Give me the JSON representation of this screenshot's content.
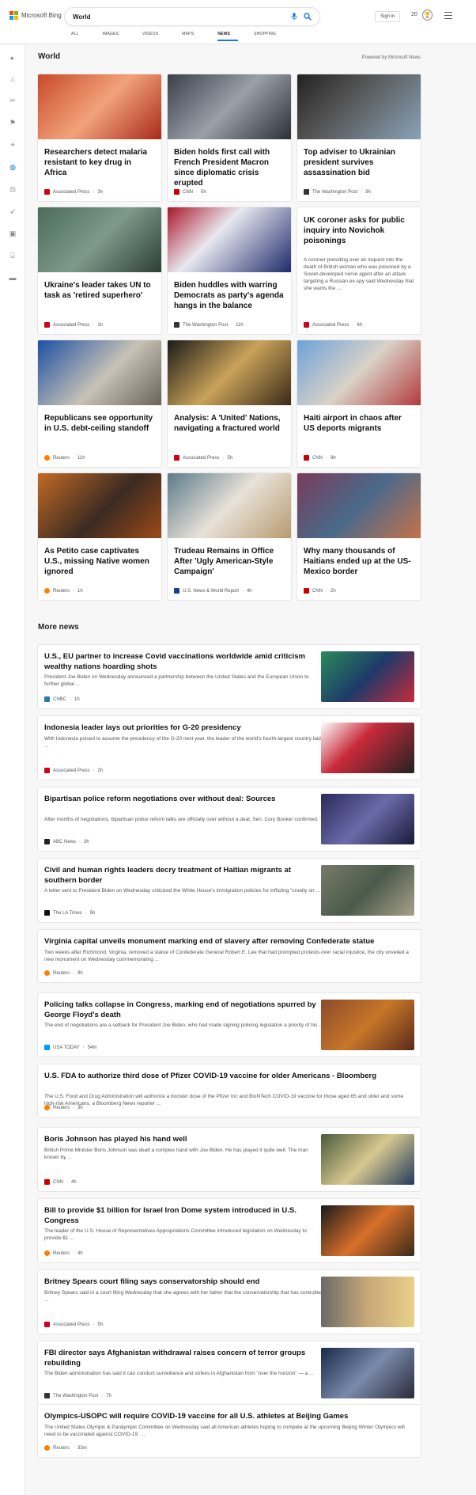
{
  "header": {
    "brand": "Microsoft Bing",
    "search_value": "World",
    "signin_label": "Sign in",
    "points": "20",
    "tabs": [
      {
        "label": "ALL",
        "active": false
      },
      {
        "label": "IMAGES",
        "active": false
      },
      {
        "label": "VIDEOS",
        "active": false
      },
      {
        "label": "MAPS",
        "active": false
      },
      {
        "label": "NEWS",
        "active": true
      },
      {
        "label": "SHOPPING",
        "active": false
      }
    ]
  },
  "section": {
    "title": "World",
    "powered": "Powered by Microsoft News"
  },
  "cards": [
    {
      "title": "Researchers detect malaria resistant to key drug in Africa",
      "source": "Associated Press",
      "time": "3h",
      "desc": ""
    },
    {
      "title": "Biden holds first call with French President Macron since diplomatic crisis erupted",
      "source": "CNN",
      "time": "5h",
      "desc": ""
    },
    {
      "title": "Top adviser to Ukrainian president survives assassination bid",
      "source": "The Washington Post",
      "time": "9h",
      "desc": ""
    },
    {
      "title": "Ukraine's leader takes UN to task as 'retired superhero'",
      "source": "Associated Press",
      "time": "1h",
      "desc": ""
    },
    {
      "title": "Biden huddles with warring Democrats as party's agenda hangs in the balance",
      "source": "The Washington Post",
      "time": "11h",
      "desc": ""
    },
    {
      "title": "UK coroner asks for public inquiry into Novichok poisonings",
      "source": "Associated Press",
      "time": "6h",
      "desc": "A coroner presiding over an inquest into the death of British woman who was poisoned by a Soviet-developed nerve agent after an attack targeting a Russian ex-spy said Wednesday that she wants the ..."
    },
    {
      "title": "Republicans see opportunity in U.S. debt-ceiling standoff",
      "source": "Reuters",
      "time": "11h",
      "desc": ""
    },
    {
      "title": "Analysis: A 'United' Nations, navigating a fractured world",
      "source": "Associated Press",
      "time": "5h",
      "desc": ""
    },
    {
      "title": "Haiti airport in chaos after US deports migrants",
      "source": "CNN",
      "time": "8h",
      "desc": ""
    },
    {
      "title": "As Petito case captivates U.S., missing Native women ignored",
      "source": "Reuters",
      "time": "1h",
      "desc": ""
    },
    {
      "title": "Trudeau Remains in Office After 'Ugly American-Style Campaign'",
      "source": "U.S. News & World Report",
      "time": "4h",
      "desc": ""
    },
    {
      "title": "Why many thousands of Haitians ended up at the US-Mexico border",
      "source": "CNN",
      "time": "2h",
      "desc": ""
    }
  ],
  "more": {
    "title": "More news",
    "items": [
      {
        "title": "U.S., EU partner to increase Covid vaccinations worldwide amid criticism wealthy nations hoarding shots",
        "desc": "President Joe Biden on Wednesday announced a partnership between the United States and the European Union to further global ...",
        "source": "CNBC",
        "time": "1h"
      },
      {
        "title": "Indonesia leader lays out priorities for G-20 presidency",
        "desc": "With Indonesia poised to assume the presidency of the G-20 next year, the leader of the world's fourth-largest country laid ...",
        "source": "Associated Press",
        "time": "2h"
      },
      {
        "title": "Bipartisan police reform negotiations over without deal: Sources",
        "desc": "After months of negotiations, bipartisan police reform talks are officially over without a deal, Sen. Cory Booker confirmed.",
        "source": "ABC News",
        "time": "3h"
      },
      {
        "title": "Civil and human rights leaders decry treatment of Haitian migrants at southern border",
        "desc": "A letter sent to President Biden on Wednesday criticized the White House's immigration policies for inflicting \"cruelty on ...",
        "source": "The LA Times",
        "time": "5h"
      },
      {
        "title": "Virginia capital unveils monument marking end of slavery after removing Confederate statue",
        "desc": "Two weeks after Richmond, Virginia, removed a statue of Confederate General Robert E. Lee that had prompted protests over racial injustice, the city unveiled a new monument on Wednesday commemorating ...",
        "source": "Reuters",
        "time": "9h"
      },
      {
        "title": "Policing talks collapse in Congress, marking end of negotiations spurred by George Floyd's death",
        "desc": "The end of negotiations are a setback for President Joe Biden, who had made signing policing legislation a priority of his ...",
        "source": "USA TODAY",
        "time": "54m"
      },
      {
        "title": "U.S. FDA to authorize third dose of Pfizer COVID-19 vaccine for older Americans - Bloomberg",
        "desc": "The U.S. Food and Drug Administration will authorize a booster dose of the Pfizer Inc and BioNTech COVID-19 vaccine for those aged 65 and older and some high-risk Americans, a Bloomberg News reporter ...",
        "source": "Reuters",
        "time": "3h"
      },
      {
        "title": "Boris Johnson has played his hand well",
        "desc": "British Prime Minister Boris Johnson was dealt a complex hand with Joe Biden. He has played it quite well. The man known by ...",
        "source": "CNN",
        "time": "4h"
      },
      {
        "title": "Bill to provide $1 billion for Israel Iron Dome system introduced in U.S. Congress",
        "desc": "The leader of the U.S. House of Representatives Appropriations Committee introduced legislation on Wednesday to provide $1 ...",
        "source": "Reuters",
        "time": "4h"
      },
      {
        "title": "Britney Spears court filing says conservatorship should end",
        "desc": "Britney Spears said in a court filing Wednesday that she agrees with her father that the conservatorship that has controlled ...",
        "source": "Associated Press",
        "time": "5h"
      },
      {
        "title": "FBI director says Afghanistan withdrawal raises concern of terror groups rebuilding",
        "desc": "The Biden administration has said it can conduct surveillance and strikes in Afghanistan from \"over the horizon\" — a ...",
        "source": "The Washington Post",
        "time": "7h"
      },
      {
        "title": "Olympics-USOPC will require COVID-19 vaccine for all U.S. athletes at Beijing Games",
        "desc": "The United States Olympic & Paralympic Committee on Wednesday said all American athletes hoping to compete at the upcoming Beijing Winter Olympics will need to be vaccinated against COVID-19. ...",
        "source": "Reuters",
        "time": "33m"
      }
    ]
  }
}
